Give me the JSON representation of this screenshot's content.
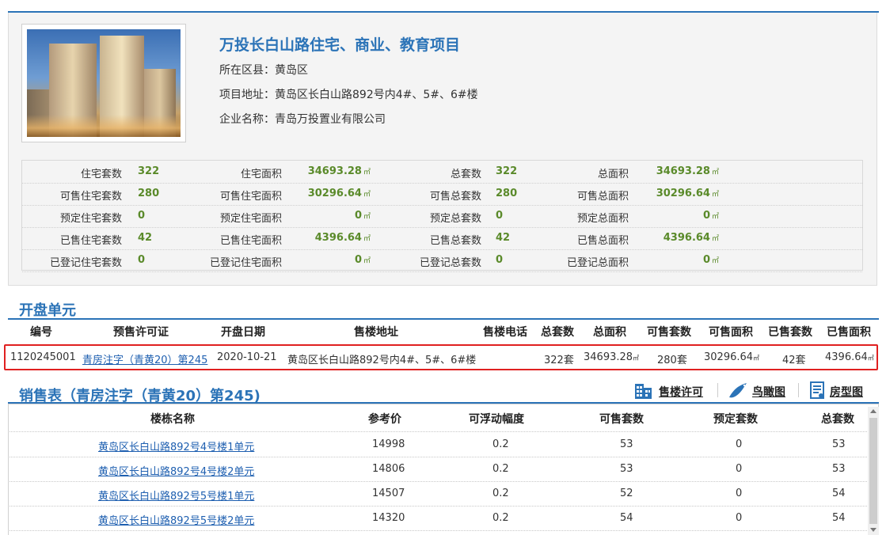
{
  "project": {
    "title": "万投长白山路住宅、商业、教育项目",
    "district_label": "所在区县：",
    "district": "黄岛区",
    "address_label": "项目地址：",
    "address": "黄岛区长白山路892号内4#、5#、6#楼",
    "company_label": "企业名称：",
    "company": "青岛万投置业有限公司",
    "photo_icon": "building-photo"
  },
  "stats": {
    "unit": "㎡",
    "rows": [
      {
        "l1": "住宅套数",
        "v1": "322",
        "l2": "住宅面积",
        "v2": "34693.28",
        "l3": "总套数",
        "v3": "322",
        "l4": "总面积",
        "v4": "34693.28"
      },
      {
        "l1": "可售住宅套数",
        "v1": "280",
        "l2": "可售住宅面积",
        "v2": "30296.64",
        "l3": "可售总套数",
        "v3": "280",
        "l4": "可售总面积",
        "v4": "30296.64"
      },
      {
        "l1": "预定住宅套数",
        "v1": "0",
        "l2": "预定住宅面积",
        "v2": "0",
        "l3": "预定总套数",
        "v3": "0",
        "l4": "预定总面积",
        "v4": "0"
      },
      {
        "l1": "已售住宅套数",
        "v1": "42",
        "l2": "已售住宅面积",
        "v2": "4396.64",
        "l3": "已售总套数",
        "v3": "42",
        "l4": "已售总面积",
        "v4": "4396.64"
      },
      {
        "l1": "已登记住宅套数",
        "v1": "0",
        "l2": "已登记住宅面积",
        "v2": "0",
        "l3": "已登记总套数",
        "v3": "0",
        "l4": "已登记总面积",
        "v4": "0"
      }
    ]
  },
  "kaipan": {
    "heading": "开盘单元",
    "columns": [
      "编号",
      "预售许可证",
      "开盘日期",
      "售楼地址",
      "售楼电话",
      "总套数",
      "总面积",
      "可售套数",
      "可售面积",
      "已售套数",
      "已售面积"
    ],
    "row": {
      "id": "1120245001",
      "permit": "青房注字（青黄20）第245",
      "date": "2020-10-21",
      "address": "黄岛区长白山路892号内4#、5#、6#楼",
      "phone": "",
      "total_units": "322套",
      "total_area": "34693.28",
      "avail_units": "280套",
      "avail_area": "30296.64",
      "sold_units": "42套",
      "sold_area": "4396.64"
    }
  },
  "sales": {
    "heading": "销售表（青房注字（青黄20）第245)",
    "tools": {
      "permit": "售楼许可",
      "permit_icon": "building-icon",
      "aerial": "鸟瞰图",
      "aerial_icon": "bird-icon",
      "floorplan": "房型图",
      "floorplan_icon": "document-icon"
    },
    "columns": [
      "楼栋名称",
      "参考价",
      "可浮动幅度",
      "可售套数",
      "预定套数",
      "总套数"
    ],
    "rows": [
      {
        "name": "黄岛区长白山路892号4号楼1单元",
        "price": "14998",
        "float": "0.2",
        "avail": "53",
        "reserved": "0",
        "total": "53"
      },
      {
        "name": "黄岛区长白山路892号4号楼2单元",
        "price": "14806",
        "float": "0.2",
        "avail": "53",
        "reserved": "0",
        "total": "53"
      },
      {
        "name": "黄岛区长白山路892号5号楼1单元",
        "price": "14507",
        "float": "0.2",
        "avail": "52",
        "reserved": "0",
        "total": "54"
      },
      {
        "name": "黄岛区长白山路892号5号楼2单元",
        "price": "14320",
        "float": "0.2",
        "avail": "54",
        "reserved": "0",
        "total": "54"
      }
    ]
  }
}
